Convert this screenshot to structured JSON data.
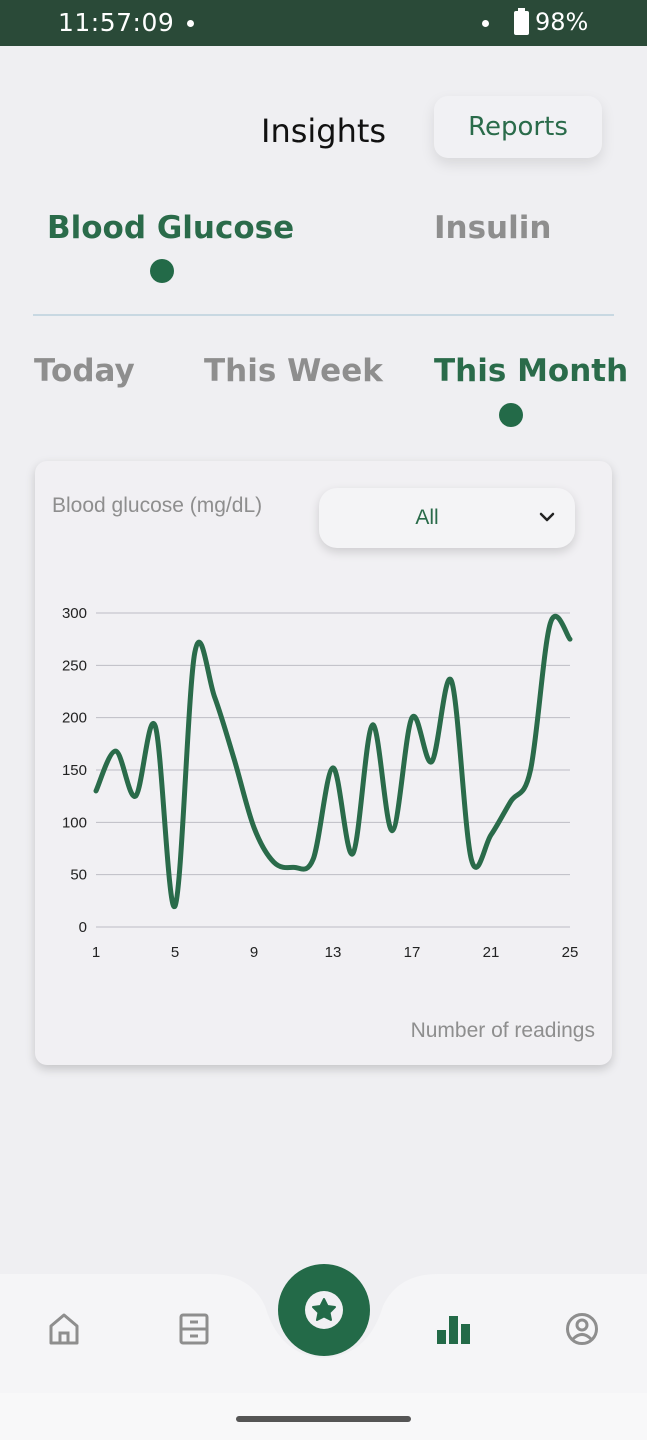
{
  "status_bar": {
    "time": "11:57:09",
    "battery": "98%"
  },
  "header": {
    "title": "Insights",
    "reports_label": "Reports"
  },
  "metric_tabs": [
    {
      "label": "Blood Glucose",
      "active": true
    },
    {
      "label": "Insulin",
      "active": false
    }
  ],
  "period_tabs": [
    {
      "label": "Today",
      "active": false
    },
    {
      "label": "This Week",
      "active": false
    },
    {
      "label": "This Month",
      "active": true
    }
  ],
  "colors": {
    "accent": "#236a48",
    "status_bar": "#2a4a38",
    "inactive": "#8e8e8e"
  },
  "card": {
    "filter": {
      "selected": "All"
    }
  },
  "chart_data": {
    "type": "line",
    "ylabel": "Blood glucose (mg/dL)",
    "xlabel": "Number of readings",
    "x_ticks": [
      1,
      5,
      9,
      13,
      17,
      21,
      25
    ],
    "y_ticks": [
      0,
      50,
      100,
      150,
      200,
      250,
      300
    ],
    "xlim": [
      1,
      25
    ],
    "ylim": [
      0,
      300
    ],
    "grid": "horizontal",
    "series": [
      {
        "color": "#2a6b4a",
        "x": [
          1,
          2,
          3,
          4,
          5,
          6,
          7,
          8,
          9,
          10,
          11,
          12,
          13,
          14,
          15,
          16,
          17,
          18,
          19,
          20,
          21,
          22,
          23,
          24,
          25
        ],
        "values": [
          130,
          168,
          125,
          192,
          20,
          262,
          220,
          160,
          95,
          62,
          57,
          65,
          152,
          70,
          193,
          92,
          200,
          158,
          235,
          65,
          88,
          120,
          150,
          290,
          275
        ]
      }
    ]
  },
  "nav": {
    "items": [
      {
        "name": "home",
        "icon": "home-icon",
        "active": false
      },
      {
        "name": "logbook",
        "icon": "logbook-icon",
        "active": false
      },
      {
        "name": "center",
        "icon": "flower-icon",
        "active": false
      },
      {
        "name": "insights",
        "icon": "bar-chart-icon",
        "active": true
      },
      {
        "name": "profile",
        "icon": "profile-icon",
        "active": false
      }
    ]
  }
}
